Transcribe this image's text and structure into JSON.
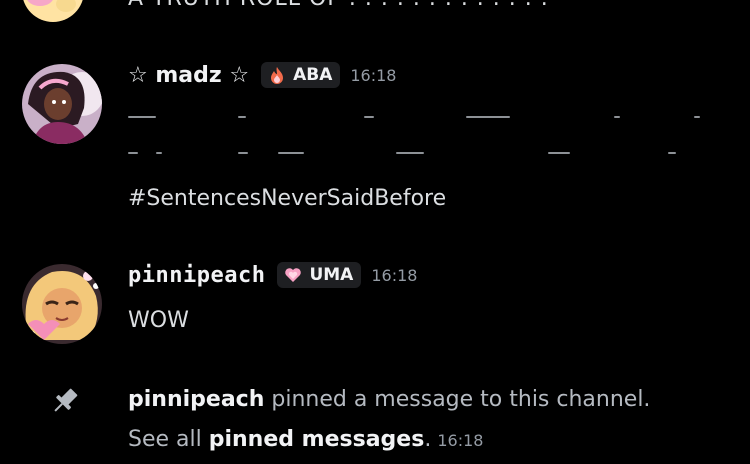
{
  "previous": {
    "partial_text": "A TRUTH ROLL OF . . . . . . . . . . . . ."
  },
  "messages": [
    {
      "username": "☆ madz ☆",
      "tag": "ABA",
      "tag_icon": "fire-icon",
      "time": "16:18",
      "line3": "#SentencesNeverSaidBefore"
    },
    {
      "username": "pinnipeach",
      "tag": "UMA",
      "tag_icon": "heart-icon",
      "time": "16:18",
      "content": "WOW"
    }
  ],
  "system": {
    "actor": "pinnipeach",
    "text1": " pinned a message to this channel. See all ",
    "link": "pinned messages",
    "text2": ".",
    "time": "16:18"
  },
  "colors": {
    "background": "#000000",
    "text": "#dbdee1",
    "muted": "#949ba4",
    "tag_bg": "#1e1f22"
  }
}
